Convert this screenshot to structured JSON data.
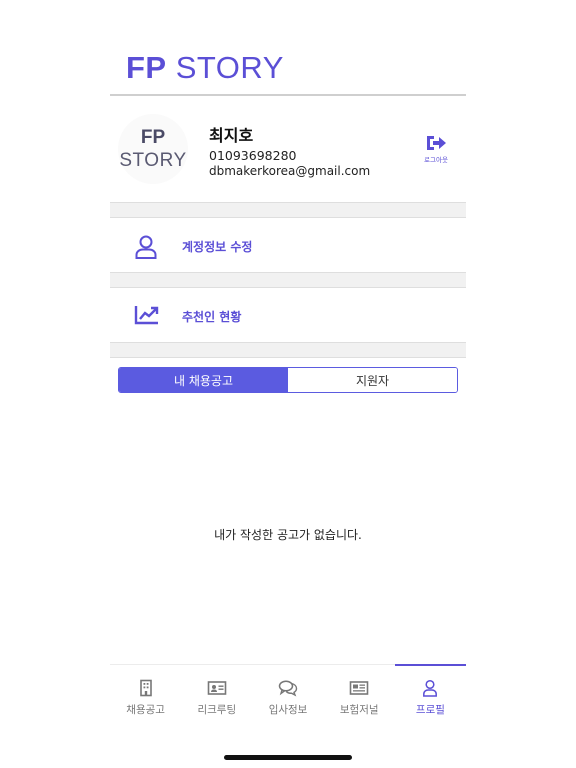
{
  "header": {
    "logo_bold": "FP",
    "logo_thin": "STORY"
  },
  "profile": {
    "avatar_line1": "FP",
    "avatar_line2": "STORY",
    "name": "최지호",
    "phone": "01093698280",
    "email": "dbmakerkorea@gmail.com",
    "logout_label": "로그아웃"
  },
  "menu": {
    "items": [
      {
        "label": "계정정보 수정",
        "icon": "user-icon"
      },
      {
        "label": "추천인 현황",
        "icon": "trend-chart-icon"
      }
    ]
  },
  "tabs": [
    {
      "label": "내 채용공고",
      "active": true
    },
    {
      "label": "지원자",
      "active": false
    }
  ],
  "empty_message": "내가 작성한 공고가 없습니다.",
  "bottom_nav": [
    {
      "label": "채용공고",
      "icon": "building-icon"
    },
    {
      "label": "리크루팅",
      "icon": "id-card-icon"
    },
    {
      "label": "입사정보",
      "icon": "chat-bubbles-icon"
    },
    {
      "label": "보험저널",
      "icon": "newspaper-icon"
    },
    {
      "label": "프로필",
      "icon": "person-icon",
      "active": true
    }
  ],
  "colors": {
    "accent": "#5b4fd6",
    "tab_active": "#5b5be0"
  }
}
